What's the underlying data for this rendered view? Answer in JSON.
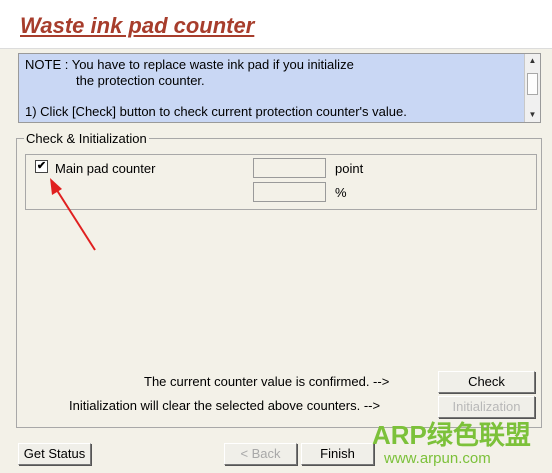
{
  "window": {
    "title": "Waste ink pad counter"
  },
  "note": {
    "line1": "NOTE : You have to replace waste ink pad if you initialize",
    "line2": "the protection counter.",
    "line3": "1) Click [Check] button to check current protection counter's value."
  },
  "group": {
    "label": "Check & Initialization",
    "main_pad": {
      "label": "Main pad counter",
      "checked": true,
      "checkmark": "✔",
      "point_value": "",
      "percent_value": "",
      "unit_point": "point",
      "unit_percent": "%"
    }
  },
  "messages": {
    "confirmed": "The current counter value is confirmed. -->",
    "init": "Initialization will clear the selected above counters. -->"
  },
  "buttons": {
    "check": "Check",
    "initialization": "Initialization",
    "get_status": "Get Status",
    "back": "< Back",
    "finish": "Finish"
  },
  "watermark": {
    "text": "ARP绿色联盟",
    "url": "www.arpun.com"
  },
  "colors": {
    "title": "#a73d2c",
    "note_bg": "#c9d7f4",
    "annotation_arrow": "#e02020",
    "watermark": "#7cc13a"
  }
}
